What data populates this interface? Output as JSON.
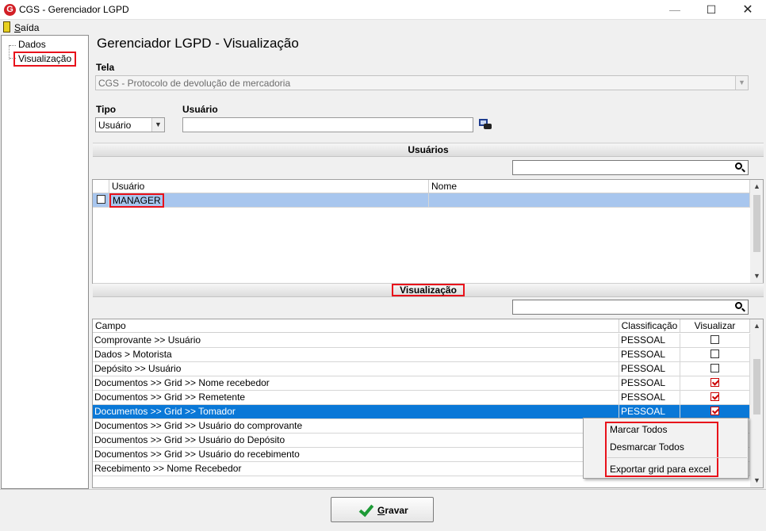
{
  "window": {
    "title": "CGS - Gerenciador LGPD",
    "app_icon_letter": "G",
    "minimize_glyph": "—",
    "maximize_glyph": "☐",
    "close_glyph": "✕"
  },
  "menu": {
    "exit_first": "S",
    "exit_rest": "aída"
  },
  "tree": {
    "items": [
      {
        "label": "Dados"
      },
      {
        "label": "Visualização"
      }
    ]
  },
  "page": {
    "title": "Gerenciador LGPD - Visualização"
  },
  "form": {
    "tela_label": "Tela",
    "tela_value": "CGS - Protocolo de devolução de mercadoria",
    "tipo_label": "Tipo",
    "tipo_value": "Usuário",
    "usuario_label": "Usuário",
    "usuario_value": ""
  },
  "users_section": {
    "title": "Usuários",
    "search_value": "",
    "columns": [
      "Usuário",
      "Nome"
    ],
    "rows": [
      {
        "usuario": "MANAGER",
        "nome": "",
        "checked": false
      }
    ]
  },
  "view_section": {
    "title": "Visualização",
    "search_value": "",
    "columns": [
      "Campo",
      "Classificação",
      "Visualizar"
    ],
    "rows": [
      {
        "campo": "Comprovante >> Usuário",
        "classificacao": "PESSOAL",
        "visualizar": false
      },
      {
        "campo": "Dados > Motorista",
        "classificacao": "PESSOAL",
        "visualizar": false
      },
      {
        "campo": "Depósito >> Usuário",
        "classificacao": "PESSOAL",
        "visualizar": false
      },
      {
        "campo": "Documentos >> Grid >> Nome recebedor",
        "classificacao": "PESSOAL",
        "visualizar": true
      },
      {
        "campo": "Documentos >> Grid >> Remetente",
        "classificacao": "PESSOAL",
        "visualizar": true
      },
      {
        "campo": "Documentos >> Grid >> Tomador",
        "classificacao": "PESSOAL",
        "visualizar": true
      },
      {
        "campo": "Documentos >> Grid >> Usuário do comprovante",
        "classificacao": "",
        "visualizar": false
      },
      {
        "campo": "Documentos >> Grid >> Usuário do Depósito",
        "classificacao": "",
        "visualizar": false
      },
      {
        "campo": "Documentos >> Grid >> Usuário do recebimento",
        "classificacao": "",
        "visualizar": false
      },
      {
        "campo": "Recebimento >> Nome Recebedor",
        "classificacao": "",
        "visualizar": false
      }
    ]
  },
  "context_menu": {
    "items": [
      "Marcar Todos",
      "Desmarcar Todos",
      "Exportar grid para excel"
    ]
  },
  "footer": {
    "save_first": "G",
    "save_rest": "ravar"
  },
  "glyphs": {
    "arrow_down": "▼",
    "arrow_up": "▲"
  },
  "colors": {
    "selection_blue": "#0a78d7",
    "selection_light": "#a8c6ee",
    "highlight_red": "#e8121b",
    "check_green": "#1d9a36"
  }
}
